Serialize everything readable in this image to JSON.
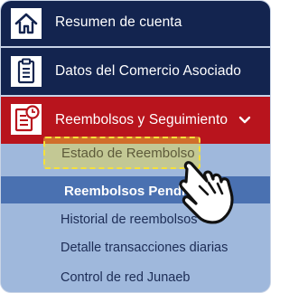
{
  "menu": {
    "items": [
      {
        "label": "Resumen de cuenta",
        "icon": "home-icon"
      },
      {
        "label": "Datos del Comercio Asociado",
        "icon": "clipboard-icon"
      },
      {
        "label": "Reembolsos y Seguimiento",
        "icon": "document-clock-icon",
        "expanded": true
      }
    ],
    "submenu": {
      "highlighted": "Estado de Reembolso",
      "active": "Reembolsos Pendientes",
      "items": [
        "Historial de reembolsos",
        "Detalle transacciones diarias",
        "Control de red Junaeb"
      ]
    }
  },
  "colors": {
    "navy": "#13244f",
    "red": "#b8141d",
    "submenu_bg": "#9fb8dc",
    "active_bg": "#4a71b1",
    "highlight": "#f5e03a"
  },
  "cursor": "hand-pointer-icon"
}
